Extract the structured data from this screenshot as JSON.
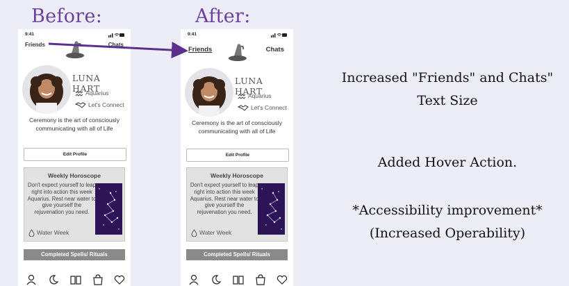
{
  "labels": {
    "before": "Before:",
    "after": "After:"
  },
  "phone": {
    "time": "9:41",
    "friends": "Friends",
    "chats": "Chats",
    "name": "LUNA HART",
    "sign": "Aquarius",
    "connect": "Let's Connect",
    "bio": "Ceremony is the art of consciously communicating with all of Life",
    "edit_profile": "Edit Profile",
    "horoscope": {
      "title": "Weekly Horoscope",
      "text": "Don't expect yourself to leap right into action this week Aquarius.  Rest near water to give yourself the rejuvenation you need.",
      "footer": "Water Week"
    },
    "spells_button": "Completed Spells/ Rituals",
    "tabs": [
      "profile-icon",
      "moon-icon",
      "book-icon",
      "bag-icon",
      "heart-icon"
    ]
  },
  "notes": {
    "line1": "Increased \"Friends\" and Chats\"",
    "line2": "Text Size",
    "line3": "Added Hover Action.",
    "line4": "*Accessibility improvement*",
    "line5": "(Increased Operability)"
  },
  "colors": {
    "accent": "#6a3f9e",
    "background": "#ededf8",
    "button_gray": "#8a8a8a"
  }
}
